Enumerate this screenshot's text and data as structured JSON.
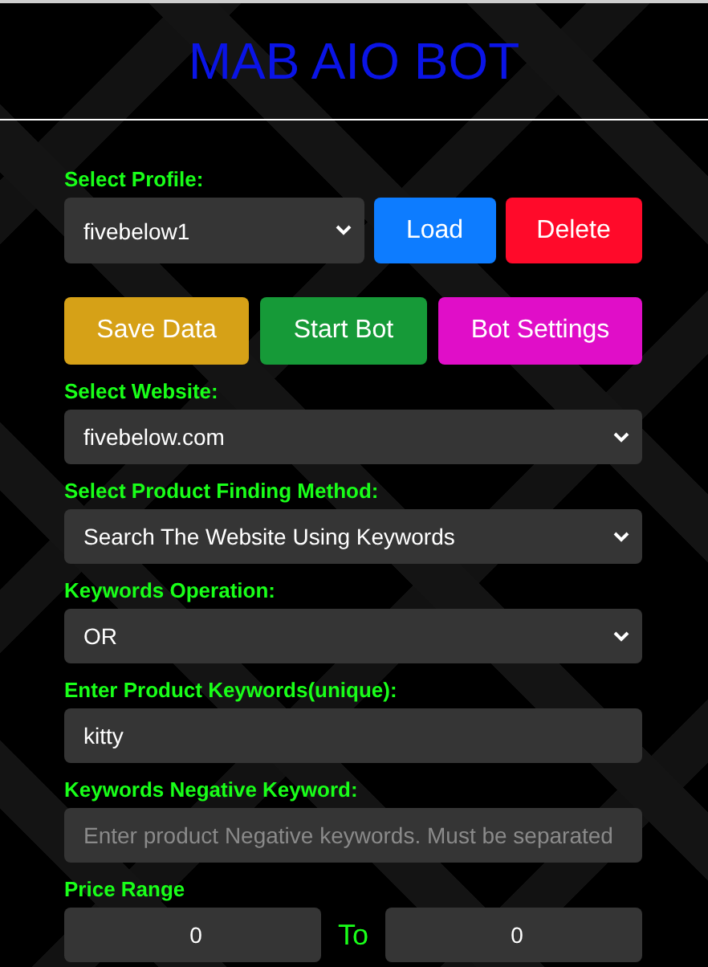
{
  "title": "MAB AIO BOT",
  "profile": {
    "label": "Select Profile:",
    "value": "fivebelow1"
  },
  "profile_buttons": [
    {
      "label": "Load",
      "kind": "load"
    },
    {
      "label": "Delete",
      "kind": "delete"
    }
  ],
  "actions": [
    {
      "label": "Save Data",
      "kind": "save"
    },
    {
      "label": "Start Bot",
      "kind": "start"
    },
    {
      "label": "Bot Settings",
      "kind": "settings"
    }
  ],
  "fields": [
    {
      "kind": "select",
      "label": "Select Website:",
      "value": "fivebelow.com"
    },
    {
      "kind": "select",
      "label": "Select Product Finding Method:",
      "value": "Search The Website Using Keywords"
    },
    {
      "kind": "select",
      "label": "Keywords Operation:",
      "value": "OR"
    },
    {
      "kind": "input",
      "label": "Enter Product Keywords(unique):",
      "value": "kitty"
    },
    {
      "kind": "input",
      "label": "Keywords Negative Keyword:",
      "placeholder": "Enter product Negative keywords. Must be separated"
    }
  ],
  "price_range": {
    "label": "Price Range",
    "min": "0",
    "separator": "To",
    "max": "0"
  }
}
